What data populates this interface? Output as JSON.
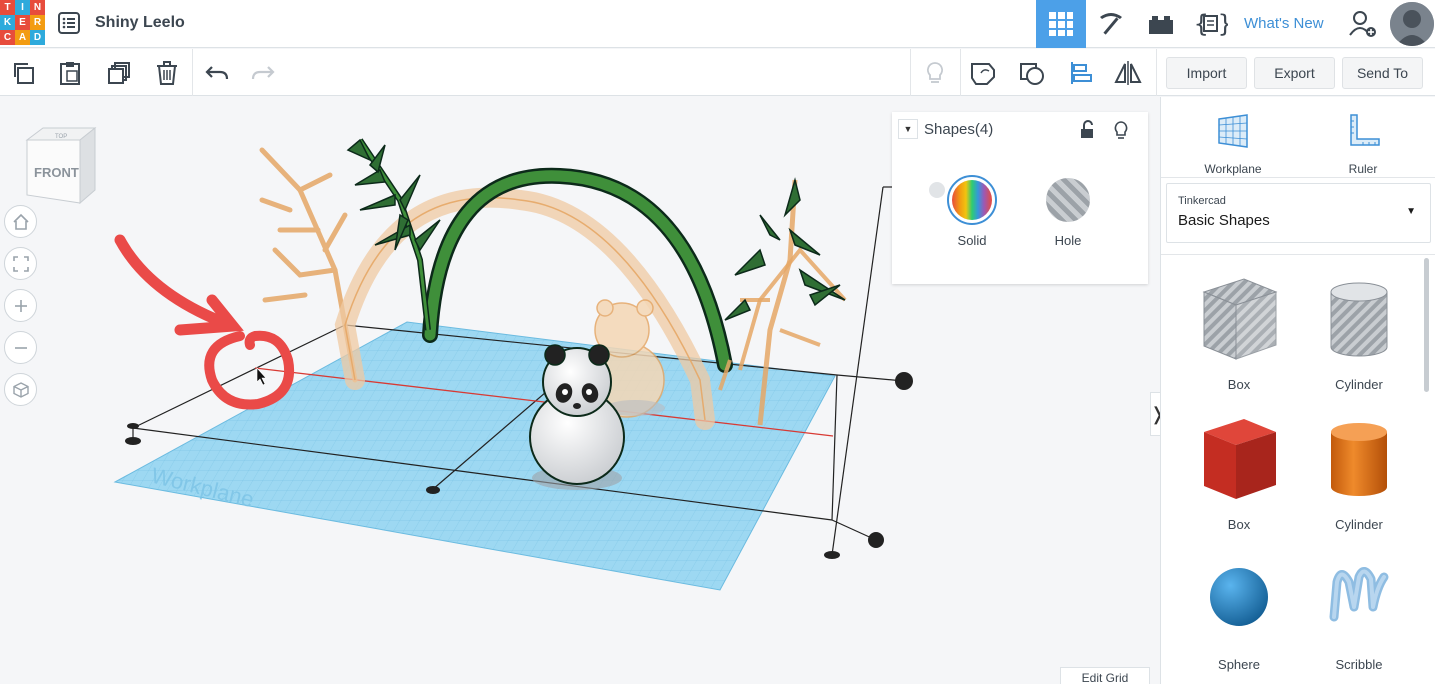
{
  "app": {
    "logo_letters": [
      "T",
      "I",
      "N",
      "K",
      "E",
      "R",
      "C",
      "A",
      "D"
    ],
    "logo_colors": [
      "#e74c3c",
      "#2eaadc",
      "#e74c3c",
      "#2eaadc",
      "#e74c3c",
      "#f39c12",
      "#e74c3c",
      "#f39c12",
      "#2eaadc"
    ],
    "project_title": "Shiny Leelo",
    "whats_new": "What's New"
  },
  "top_icons": [
    "grid-view-icon",
    "pickaxe-icon",
    "bricks-icon",
    "codeblocks-icon"
  ],
  "toolbar": {
    "import": "Import",
    "export": "Export",
    "send_to": "Send To"
  },
  "viewcube": {
    "front": "FRONT",
    "top": "TOP"
  },
  "workplane_watermark": "Workplane",
  "inspector": {
    "title": "Shapes(4)",
    "solid": "Solid",
    "hole": "Hole"
  },
  "edit_grid": "Edit Grid",
  "panel": {
    "workplane": "Workplane",
    "ruler": "Ruler",
    "library_category": "Tinkercad",
    "library_value": "Basic Shapes",
    "shapes": [
      {
        "label": "Box",
        "icon": "box-hole-icon"
      },
      {
        "label": "Cylinder",
        "icon": "cylinder-hole-icon"
      },
      {
        "label": "Box",
        "icon": "box-red-icon"
      },
      {
        "label": "Cylinder",
        "icon": "cylinder-orange-icon"
      },
      {
        "label": "Sphere",
        "icon": "sphere-blue-icon"
      },
      {
        "label": "Scribble",
        "icon": "scribble-icon"
      }
    ]
  },
  "colors": {
    "accent": "#3d8fd6",
    "active_tab": "#4ca0e8",
    "workplane": "#8fd3f0",
    "annotation": "#ea4a48",
    "stem_green": "#3f8f3a",
    "orange_outline": "#e5a766"
  }
}
